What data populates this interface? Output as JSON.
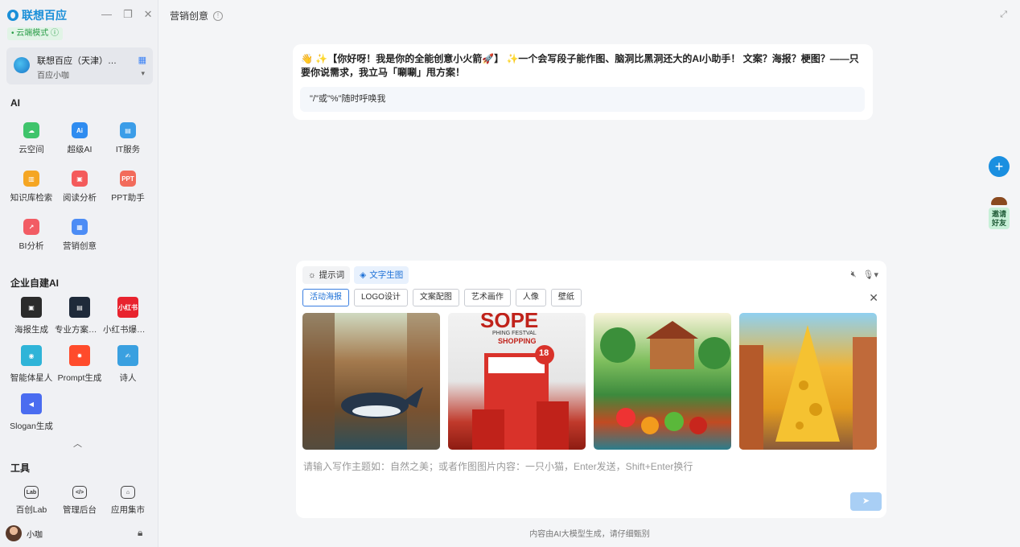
{
  "app": {
    "name": "联想百应",
    "mode": "云端模式",
    "win_min": "—",
    "win_restore": "❐",
    "win_close": "✕"
  },
  "account": {
    "org": "联想百应（天津）…",
    "user": "百应小咖"
  },
  "sidebar": {
    "ai_section": "AI",
    "ai_apps": [
      {
        "label": "云空间",
        "color": "#3fc46b",
        "glyph": "☁"
      },
      {
        "label": "超级AI",
        "color": "#2f8cf0",
        "glyph": "Ai"
      },
      {
        "label": "IT服务",
        "color": "#3b9de8",
        "glyph": "▤"
      },
      {
        "label": "知识库检索",
        "color": "#f5a623",
        "glyph": "▥"
      },
      {
        "label": "阅读分析",
        "color": "#f45b5b",
        "glyph": "▣"
      },
      {
        "label": "PPT助手",
        "color": "#f26b5b",
        "glyph": "PPT"
      },
      {
        "label": "BI分析",
        "color": "#f25c64",
        "glyph": "↗"
      },
      {
        "label": "营销创意",
        "color": "#4c8cf5",
        "glyph": "▦"
      }
    ],
    "ent_section": "企业自建AI",
    "ent_apps": [
      {
        "label": "海报生成",
        "color": "#2b2b2b",
        "glyph": "▣"
      },
      {
        "label": "专业方案策…",
        "color": "#1f2a3a",
        "glyph": "▤"
      },
      {
        "label": "小红书爆款…",
        "color": "#e8232e",
        "glyph": "小红书"
      },
      {
        "label": "智能体星人",
        "color": "#2fb4d8",
        "glyph": "◉"
      },
      {
        "label": "Prompt生成",
        "color": "#ff4b2b",
        "glyph": "✹"
      },
      {
        "label": "诗人",
        "color": "#3aa0e0",
        "glyph": "✍"
      },
      {
        "label": "Slogan生成",
        "color": "#4a6cf0",
        "glyph": "◀"
      }
    ],
    "collapse": "︿",
    "tools_section": "工具",
    "tools": [
      {
        "label": "百创Lab",
        "glyph": "Lab"
      },
      {
        "label": "管理后台",
        "glyph": "</>"
      },
      {
        "label": "应用集市",
        "glyph": "⌂"
      }
    ],
    "user_name": "小咖"
  },
  "page": {
    "title": "营销创意"
  },
  "greeting": {
    "text": "👋 ✨【你好呀！我是你的全能创意小火箭🚀】 ✨一个会写段子能作图、脑洞比黑洞还大的AI小助手！ 文案？海报？梗图？——只要你说需求，我立马「唰唰」甩方案！",
    "hint": "\"/\"或\"%\"随时呼唤我"
  },
  "side_actions": {
    "plus": "+",
    "invite": "邀请好友"
  },
  "composer": {
    "mode_tabs": [
      {
        "label": "提示词",
        "icon": "bulb-icon"
      },
      {
        "label": "文字生图",
        "icon": "image-icon"
      }
    ],
    "categories": [
      "活动海报",
      "LOGO设计",
      "文案配图",
      "艺术画作",
      "人像",
      "壁纸"
    ],
    "active_category": "活动海报",
    "poster_text": {
      "big": "SOPE",
      "sub": "PHING FESTVAL",
      "shop": "SHOPPING",
      "badge": "18"
    },
    "placeholder": "请输入写作主题如：自然之美；或者作图图片内容：一只小猫，Enter发送，Shift+Enter换行",
    "send_icon": "➤"
  },
  "footer": "内容由AI大模型生成，请仔细甄别"
}
